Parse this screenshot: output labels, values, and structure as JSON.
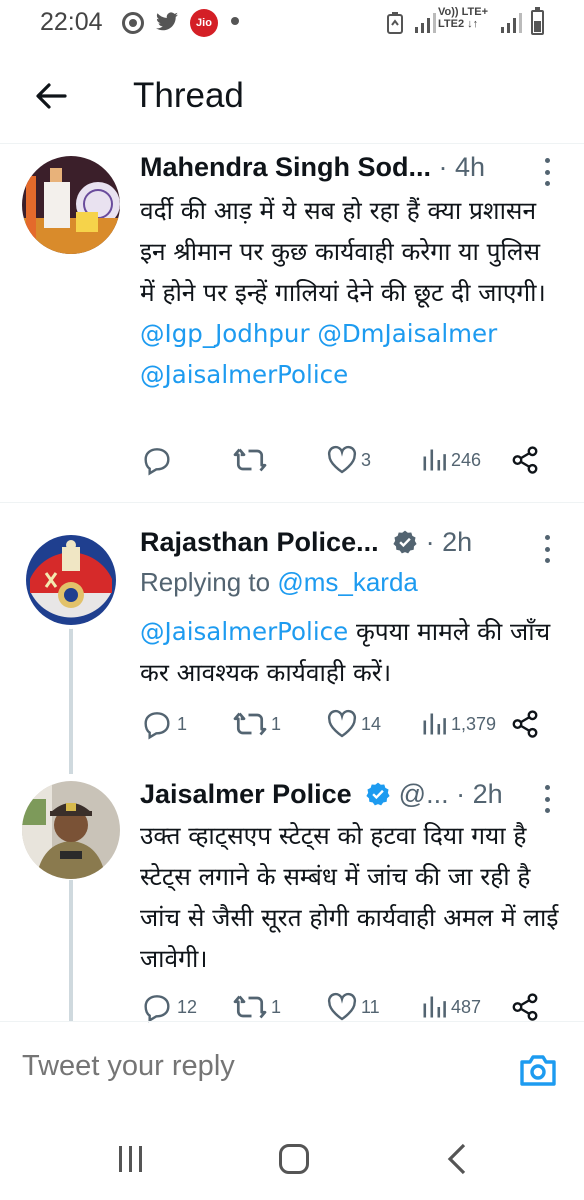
{
  "status_bar": {
    "time": "22:04",
    "jio_label": "Jio",
    "network_line1": "Vo)) LTE+",
    "network_line2": "LTE2 ↓↑"
  },
  "header": {
    "title": "Thread"
  },
  "tweets": [
    {
      "author": "Mahendra Singh Sod...",
      "time": "· 4h",
      "text": "वर्दी की आड़ में ये सब हो रहा हैं क्या प्रशासन इन श्रीमान पर कुछ कार्यवाही करेगा या पुलिस में होने पर इन्हें गालियां देने की छूट दी जाएगी।",
      "mentions": "@Igp_Jodhpur @DmJaisalmer @JaisalmerPolice",
      "replies": "",
      "retweets": "",
      "likes": "3",
      "views": "246"
    },
    {
      "author": "Rajasthan Police...",
      "time": "· 2h",
      "replying_prefix": "Replying to",
      "replying_handle": "@ms_karda",
      "mention": "@JaisalmerPolice",
      "text": " कृपया मामले की जाँच कर आवश्यक कार्यवाही करें।",
      "replies": "1",
      "retweets": "1",
      "likes": "14",
      "views": "1,379"
    },
    {
      "author": "Jaisalmer Police",
      "handle": "@...",
      "time": "· 2h",
      "text": "उक्त व्हाट्सएप स्टेट्स को हटवा दिया गया है स्टेट्स लगाने  के सम्बंध में जांच की जा रही है जांच से जैसी सूरत होगी कार्यवाही अमल में लाई जावेगी।",
      "replies": "12",
      "retweets": "1",
      "likes": "11",
      "views": "487"
    }
  ],
  "reply_bar": {
    "placeholder": "Tweet your reply"
  },
  "colors": {
    "link": "#1d9bf0",
    "verified": "#1d9bf0",
    "muted": "#536471",
    "text": "#0f1419"
  },
  "icons": [
    "back-arrow-icon",
    "more-icon",
    "reply-icon",
    "retweet-icon",
    "like-icon",
    "views-icon",
    "share-icon",
    "verified-badge-icon",
    "camera-icon"
  ]
}
